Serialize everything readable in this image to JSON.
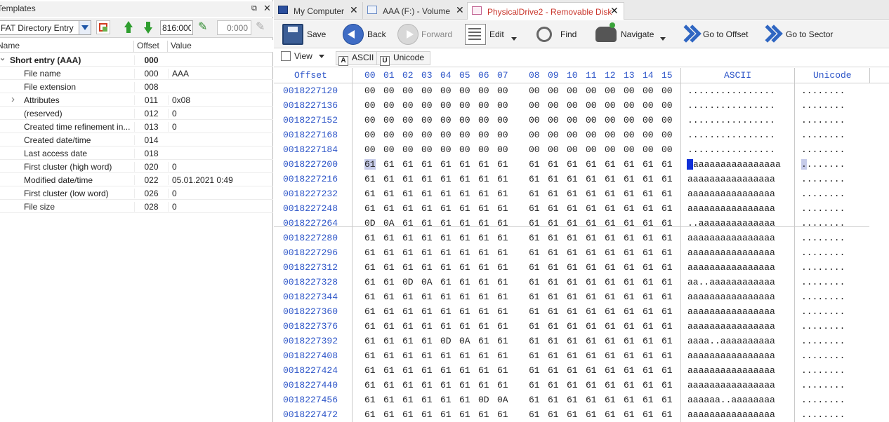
{
  "templates_panel": {
    "title": "Templates",
    "template_name": "FAT Directory Entry",
    "offset_value": "816:000",
    "offset_placeholder": "0:000",
    "headers": {
      "name": "Name",
      "offset": "Offset",
      "value": "Value"
    },
    "rows": [
      {
        "name": "Short entry (AAA)",
        "offset": "000",
        "value": "",
        "bold": true,
        "expanded": true
      },
      {
        "name": "File name",
        "offset": "000",
        "value": "AAA"
      },
      {
        "name": "File extension",
        "offset": "008",
        "value": ""
      },
      {
        "name": "Attributes",
        "offset": "011",
        "value": "0x08",
        "collapsed": true
      },
      {
        "name": "(reserved)",
        "offset": "012",
        "value": "0"
      },
      {
        "name": "Created time refinement in...",
        "offset": "013",
        "value": "0"
      },
      {
        "name": "Created date/time",
        "offset": "014",
        "value": ""
      },
      {
        "name": "Last access date",
        "offset": "018",
        "value": ""
      },
      {
        "name": "First cluster (high word)",
        "offset": "020",
        "value": "0"
      },
      {
        "name": "Modified date/time",
        "offset": "022",
        "value": "05.01.2021 0:49"
      },
      {
        "name": "First cluster (low word)",
        "offset": "026",
        "value": "0"
      },
      {
        "name": "File size",
        "offset": "028",
        "value": "0"
      }
    ]
  },
  "tabs": [
    {
      "label": "My Computer",
      "active": false
    },
    {
      "label": "AAA (F:) - Volume",
      "active": false
    },
    {
      "label": "PhysicalDrive2 - Removable Disk",
      "active": true,
      "color": "#c9342a"
    }
  ],
  "toolbar": {
    "save": "Save",
    "back": "Back",
    "forward": "Forward",
    "edit": "Edit",
    "find": "Find",
    "navigate": "Navigate",
    "goto_offset": "Go to Offset",
    "goto_sector": "Go to Sector"
  },
  "toolbar2": {
    "view": "View",
    "ascii": "ASCII",
    "unicode": "Unicode",
    "ascii_icon": "A",
    "unicode_icon": "U"
  },
  "hex": {
    "header_offset": "Offset",
    "header_ascii": "ASCII",
    "header_unicode": "Unicode",
    "columns": [
      "00",
      "01",
      "02",
      "03",
      "04",
      "05",
      "06",
      "07",
      "08",
      "09",
      "10",
      "11",
      "12",
      "13",
      "14",
      "15"
    ],
    "rows": [
      {
        "offset": "0018227120",
        "bytes": [
          "00",
          "00",
          "00",
          "00",
          "00",
          "00",
          "00",
          "00",
          "00",
          "00",
          "00",
          "00",
          "00",
          "00",
          "00",
          "00"
        ],
        "ascii": "................",
        "unicode": "........"
      },
      {
        "offset": "0018227136",
        "bytes": [
          "00",
          "00",
          "00",
          "00",
          "00",
          "00",
          "00",
          "00",
          "00",
          "00",
          "00",
          "00",
          "00",
          "00",
          "00",
          "00"
        ],
        "ascii": "................",
        "unicode": "........"
      },
      {
        "offset": "0018227152",
        "bytes": [
          "00",
          "00",
          "00",
          "00",
          "00",
          "00",
          "00",
          "00",
          "00",
          "00",
          "00",
          "00",
          "00",
          "00",
          "00",
          "00"
        ],
        "ascii": "................",
        "unicode": "........"
      },
      {
        "offset": "0018227168",
        "bytes": [
          "00",
          "00",
          "00",
          "00",
          "00",
          "00",
          "00",
          "00",
          "00",
          "00",
          "00",
          "00",
          "00",
          "00",
          "00",
          "00"
        ],
        "ascii": "................",
        "unicode": "........"
      },
      {
        "offset": "0018227184",
        "bytes": [
          "00",
          "00",
          "00",
          "00",
          "00",
          "00",
          "00",
          "00",
          "00",
          "00",
          "00",
          "00",
          "00",
          "00",
          "00",
          "00"
        ],
        "ascii": "................",
        "unicode": "........"
      },
      {
        "offset": "0018227200",
        "bytes": [
          "61",
          "61",
          "61",
          "61",
          "61",
          "61",
          "61",
          "61",
          "61",
          "61",
          "61",
          "61",
          "61",
          "61",
          "61",
          "61"
        ],
        "ascii": "aaaaaaaaaaaaaaaa",
        "unicode": "........",
        "selected": true
      },
      {
        "offset": "0018227216",
        "bytes": [
          "61",
          "61",
          "61",
          "61",
          "61",
          "61",
          "61",
          "61",
          "61",
          "61",
          "61",
          "61",
          "61",
          "61",
          "61",
          "61"
        ],
        "ascii": "aaaaaaaaaaaaaaaa",
        "unicode": "........"
      },
      {
        "offset": "0018227232",
        "bytes": [
          "61",
          "61",
          "61",
          "61",
          "61",
          "61",
          "61",
          "61",
          "61",
          "61",
          "61",
          "61",
          "61",
          "61",
          "61",
          "61"
        ],
        "ascii": "aaaaaaaaaaaaaaaa",
        "unicode": "........"
      },
      {
        "offset": "0018227248",
        "bytes": [
          "61",
          "61",
          "61",
          "61",
          "61",
          "61",
          "61",
          "61",
          "61",
          "61",
          "61",
          "61",
          "61",
          "61",
          "61",
          "61"
        ],
        "ascii": "aaaaaaaaaaaaaaaa",
        "unicode": "........"
      },
      {
        "offset": "0018227264",
        "bytes": [
          "0D",
          "0A",
          "61",
          "61",
          "61",
          "61",
          "61",
          "61",
          "61",
          "61",
          "61",
          "61",
          "61",
          "61",
          "61",
          "61"
        ],
        "ascii": "..aaaaaaaaaaaaaa",
        "unicode": "........"
      },
      {
        "offset": "0018227280",
        "bytes": [
          "61",
          "61",
          "61",
          "61",
          "61",
          "61",
          "61",
          "61",
          "61",
          "61",
          "61",
          "61",
          "61",
          "61",
          "61",
          "61"
        ],
        "ascii": "aaaaaaaaaaaaaaaa",
        "unicode": "........"
      },
      {
        "offset": "0018227296",
        "bytes": [
          "61",
          "61",
          "61",
          "61",
          "61",
          "61",
          "61",
          "61",
          "61",
          "61",
          "61",
          "61",
          "61",
          "61",
          "61",
          "61"
        ],
        "ascii": "aaaaaaaaaaaaaaaa",
        "unicode": "........"
      },
      {
        "offset": "0018227312",
        "bytes": [
          "61",
          "61",
          "61",
          "61",
          "61",
          "61",
          "61",
          "61",
          "61",
          "61",
          "61",
          "61",
          "61",
          "61",
          "61",
          "61"
        ],
        "ascii": "aaaaaaaaaaaaaaaa",
        "unicode": "........"
      },
      {
        "offset": "0018227328",
        "bytes": [
          "61",
          "61",
          "0D",
          "0A",
          "61",
          "61",
          "61",
          "61",
          "61",
          "61",
          "61",
          "61",
          "61",
          "61",
          "61",
          "61"
        ],
        "ascii": "aa..aaaaaaaaaaaa",
        "unicode": "........"
      },
      {
        "offset": "0018227344",
        "bytes": [
          "61",
          "61",
          "61",
          "61",
          "61",
          "61",
          "61",
          "61",
          "61",
          "61",
          "61",
          "61",
          "61",
          "61",
          "61",
          "61"
        ],
        "ascii": "aaaaaaaaaaaaaaaa",
        "unicode": "........"
      },
      {
        "offset": "0018227360",
        "bytes": [
          "61",
          "61",
          "61",
          "61",
          "61",
          "61",
          "61",
          "61",
          "61",
          "61",
          "61",
          "61",
          "61",
          "61",
          "61",
          "61"
        ],
        "ascii": "aaaaaaaaaaaaaaaa",
        "unicode": "........"
      },
      {
        "offset": "0018227376",
        "bytes": [
          "61",
          "61",
          "61",
          "61",
          "61",
          "61",
          "61",
          "61",
          "61",
          "61",
          "61",
          "61",
          "61",
          "61",
          "61",
          "61"
        ],
        "ascii": "aaaaaaaaaaaaaaaa",
        "unicode": "........"
      },
      {
        "offset": "0018227392",
        "bytes": [
          "61",
          "61",
          "61",
          "61",
          "0D",
          "0A",
          "61",
          "61",
          "61",
          "61",
          "61",
          "61",
          "61",
          "61",
          "61",
          "61"
        ],
        "ascii": "aaaa..aaaaaaaaaa",
        "unicode": "........"
      },
      {
        "offset": "0018227408",
        "bytes": [
          "61",
          "61",
          "61",
          "61",
          "61",
          "61",
          "61",
          "61",
          "61",
          "61",
          "61",
          "61",
          "61",
          "61",
          "61",
          "61"
        ],
        "ascii": "aaaaaaaaaaaaaaaa",
        "unicode": "........"
      },
      {
        "offset": "0018227424",
        "bytes": [
          "61",
          "61",
          "61",
          "61",
          "61",
          "61",
          "61",
          "61",
          "61",
          "61",
          "61",
          "61",
          "61",
          "61",
          "61",
          "61"
        ],
        "ascii": "aaaaaaaaaaaaaaaa",
        "unicode": "........"
      },
      {
        "offset": "0018227440",
        "bytes": [
          "61",
          "61",
          "61",
          "61",
          "61",
          "61",
          "61",
          "61",
          "61",
          "61",
          "61",
          "61",
          "61",
          "61",
          "61",
          "61"
        ],
        "ascii": "aaaaaaaaaaaaaaaa",
        "unicode": "........"
      },
      {
        "offset": "0018227456",
        "bytes": [
          "61",
          "61",
          "61",
          "61",
          "61",
          "61",
          "0D",
          "0A",
          "61",
          "61",
          "61",
          "61",
          "61",
          "61",
          "61",
          "61"
        ],
        "ascii": "aaaaaa..aaaaaaaa",
        "unicode": "........"
      },
      {
        "offset": "0018227472",
        "bytes": [
          "61",
          "61",
          "61",
          "61",
          "61",
          "61",
          "61",
          "61",
          "61",
          "61",
          "61",
          "61",
          "61",
          "61",
          "61",
          "61"
        ],
        "ascii": "aaaaaaaaaaaaaaaa",
        "unicode": "........"
      }
    ]
  },
  "colors": {
    "offset_blue": "#2d55c8",
    "selection": "#c6cbe9",
    "cursor": "#1030d8",
    "active_tab_text": "#c9342a"
  }
}
